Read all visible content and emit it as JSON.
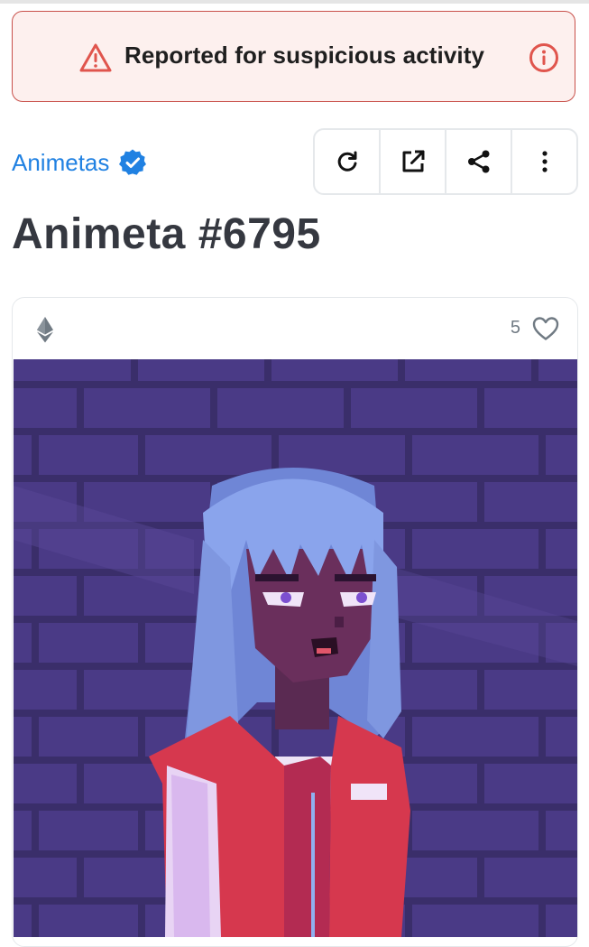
{
  "banner": {
    "text": "Reported for suspicious activity",
    "warning_icon": "warning-triangle-icon",
    "info_icon": "info-circle-icon",
    "colors": {
      "border": "#c8504a",
      "background": "#fdf0ee"
    }
  },
  "collection": {
    "name": "Animetas",
    "verified": true,
    "color": "#2081e2"
  },
  "actions": [
    {
      "name": "refresh",
      "icon": "refresh-icon"
    },
    {
      "name": "open-external",
      "icon": "external-link-icon"
    },
    {
      "name": "share",
      "icon": "share-icon"
    },
    {
      "name": "more",
      "icon": "more-vertical-icon"
    }
  ],
  "item": {
    "title": "Animeta #6795"
  },
  "media": {
    "chain_icon": "ethereum-icon",
    "favorites_count": "5",
    "favorite_icon": "heart-outline-icon",
    "artwork_description_icon": "pixel-art-character-image"
  }
}
